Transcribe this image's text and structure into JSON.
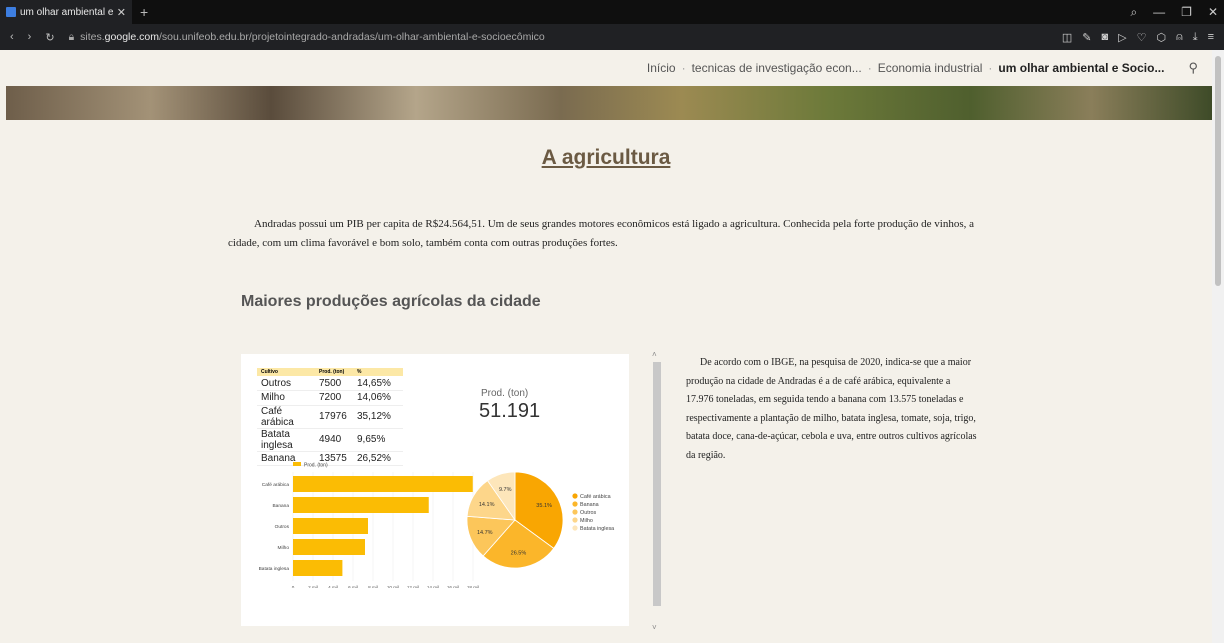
{
  "browser": {
    "tab_title": "um olhar ambiental e Socio",
    "tab_close": "✕",
    "new_tab": "+",
    "url_prefix": "sites.",
    "url_domain": "google.com",
    "url_path": "/sou.unifeob.edu.br/projetointegrado-andradas/um-olhar-ambiental-e-socioecômico"
  },
  "nav": {
    "items": [
      "Início",
      "tecnicas de investigação econ...",
      "Economia industrial"
    ],
    "current": "um olhar ambiental e Socio..."
  },
  "page": {
    "title": "A agricultura",
    "intro": "Andradas possui um PIB per capita de R$24.564,51. Um de seus grandes motores econômicos está ligado a agricultura. Conhecida pela forte produção de vinhos, a cidade, com um clima favorável e bom solo,  também conta com outras produções fortes.",
    "section_title": "Maiores produções agrícolas da cidade",
    "side_text": "De acordo com o IBGE, na pesquisa de 2020, indica-se que a maior produção na cidade de Andradas é a de café arábica, equivalente a 17.976 toneladas, em seguida tendo a banana com 13.575 toneladas e respectivamente a plantação de milho, batata inglesa, tomate, soja, trigo, batata doce, cana-de-açúcar, cebola e uva, entre outros cultivos agrícolas da região."
  },
  "table": {
    "headers": [
      "Cultivo",
      "Prod. (ton)",
      "%"
    ],
    "rows": [
      [
        "Outros",
        "7500",
        "14,65%"
      ],
      [
        "Milho",
        "7200",
        "14,06%"
      ],
      [
        "Café arábica",
        "17976",
        "35,12%"
      ],
      [
        "Batata inglesa",
        "4940",
        "9,65%"
      ],
      [
        "Banana",
        "13575",
        "26,52%"
      ]
    ]
  },
  "kpi": {
    "label": "Prod. (ton)",
    "value": "51.191"
  },
  "chart_data": [
    {
      "type": "bar",
      "orientation": "horizontal",
      "legend": "Prod. (ton)",
      "categories": [
        "Café arábica",
        "Banana",
        "Outros",
        "Milho",
        "Batata inglesa"
      ],
      "values": [
        17976,
        13575,
        7500,
        7200,
        4940
      ],
      "xticks": [
        "0",
        "2 mil",
        "4 mil",
        "6 mil",
        "8 mil",
        "10 mil",
        "12 mil",
        "14 mil",
        "16 mil",
        "18 mil"
      ],
      "xlim": [
        0,
        18000
      ],
      "color": "#fbbc04"
    },
    {
      "type": "pie",
      "donut": false,
      "categories": [
        "Café arábica",
        "Banana",
        "Outros",
        "Milho",
        "Batata inglesa"
      ],
      "values": [
        35.1,
        26.5,
        14.7,
        14.1,
        9.7
      ],
      "labels": [
        "35.1%",
        "26.5%",
        "14.7%",
        "14.1%",
        "9.7%"
      ],
      "colors": [
        "#f9a602",
        "#fbb62a",
        "#fcc65a",
        "#fdd68a",
        "#fde6ba"
      ],
      "legend_position": "right"
    }
  ]
}
